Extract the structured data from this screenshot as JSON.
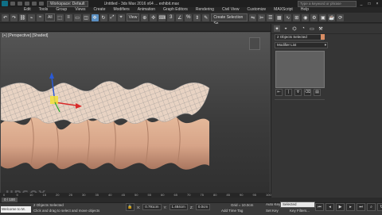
{
  "titlebar": {
    "workspace": "Workspace: Default",
    "title": "Untitled - 3ds Max 2016 x64 ... exhibit.max",
    "search_placeholder": "Type a keyword or phrase",
    "controls": [
      "_",
      "□",
      "×"
    ]
  },
  "menu": [
    "Edit",
    "Tools",
    "Group",
    "Views",
    "Create",
    "Modifiers",
    "Animation",
    "Graph Editors",
    "Rendering",
    "Civil View",
    "Customize",
    "MAXScript",
    "Help"
  ],
  "toolbar": {
    "filter_value": "All",
    "view_value": "View",
    "selection_set_placeholder": "Create Selection Se"
  },
  "viewport": {
    "label": "[+] [Perspective] [Shaded]"
  },
  "right_panel": {
    "object_selection": "2 Objects Selected",
    "modifier_list": "Modifier List",
    "stack_buttons": [
      "⇤",
      "|",
      "∀",
      "⌫",
      "▤"
    ]
  },
  "timeline": {
    "frame_label": "0 / 100",
    "ticks": [
      "0",
      "5",
      "10",
      "15",
      "20",
      "25",
      "30",
      "35",
      "40",
      "45",
      "50",
      "55",
      "60",
      "65",
      "70",
      "75",
      "80",
      "85",
      "90",
      "95",
      "100"
    ]
  },
  "status": {
    "welcome": "Welcome to M.",
    "objects_selected": "2 Objects Selected",
    "prompt": "Click and drag to select and move objects",
    "x_label": "X:",
    "x_value": "0.791cm",
    "y_label": "Y:",
    "y_value": "1.484cm",
    "z_label": "Z:",
    "z_value": "0.0cm",
    "grid": "Grid = 10.0cm",
    "auto_key": "Auto Key",
    "auto_key_value": "Selected",
    "set_key": "Set Key",
    "key_filters": "Key Filters...",
    "add_time_tag": "Add Time Tag"
  },
  "watermark": "UPSOX"
}
